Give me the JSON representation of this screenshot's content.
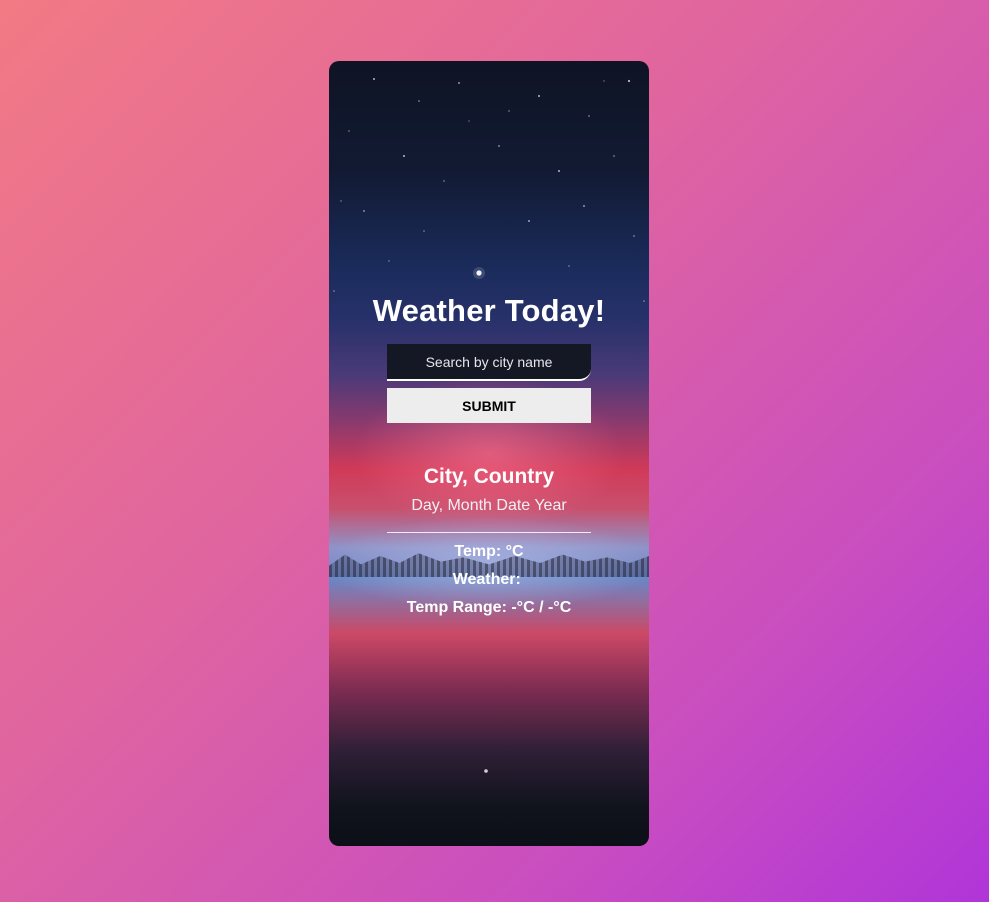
{
  "app": {
    "title": "Weather Today!"
  },
  "search": {
    "placeholder": "Search by city name",
    "value": ""
  },
  "submit": {
    "label": "SUBMIT"
  },
  "result": {
    "location": "City, Country",
    "date": "Day, Month Date Year",
    "temp": "Temp: °C",
    "weather": "Weather: ",
    "temp_range": "Temp Range: -°C / -°C"
  },
  "colors": {
    "background_start": "#f27a84",
    "background_end": "#b035d8",
    "card_dark": "#0e1424",
    "button_bg": "#ededed",
    "text": "#ffffff"
  },
  "icons": {
    "card_background": "night-lake-landscape-image"
  }
}
